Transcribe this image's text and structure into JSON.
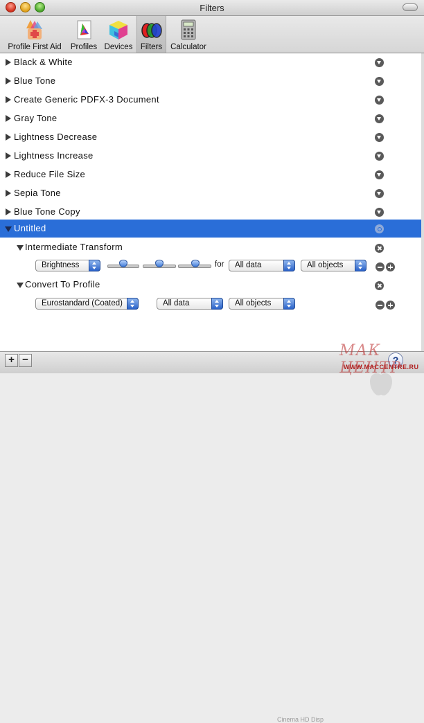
{
  "window": {
    "title": "Filters"
  },
  "toolbar": {
    "items": [
      {
        "label": "Profile First Aid",
        "icon": "profile-first-aid-icon",
        "selected": false
      },
      {
        "label": "Profiles",
        "icon": "profiles-icon",
        "selected": false
      },
      {
        "label": "Devices",
        "icon": "devices-icon",
        "selected": false
      },
      {
        "label": "Filters",
        "icon": "filters-icon",
        "selected": true
      },
      {
        "label": "Calculator",
        "icon": "calculator-icon",
        "selected": false
      }
    ]
  },
  "filters": [
    {
      "label": "Black & White"
    },
    {
      "label": "Blue Tone"
    },
    {
      "label": "Create Generic PDFX-3 Document"
    },
    {
      "label": "Gray Tone"
    },
    {
      "label": "Lightness Decrease"
    },
    {
      "label": "Lightness Increase"
    },
    {
      "label": "Reduce File Size"
    },
    {
      "label": "Sepia Tone"
    },
    {
      "label": "Blue Tone Copy"
    },
    {
      "label": "Untitled",
      "selected": true,
      "expanded": true
    }
  ],
  "components": {
    "intermediate": {
      "label": "Intermediate Transform",
      "type_value": "Brightness",
      "slider_values": [
        0.5,
        0.5,
        0.5
      ],
      "for_label": "for",
      "data_value": "All data",
      "objects_value": "All objects"
    },
    "convert": {
      "label": "Convert To Profile",
      "profile_value": "Eurostandard (Coated)",
      "data_value": "All data",
      "objects_value": "All objects"
    }
  },
  "bottombar": {
    "add_label": "+",
    "remove_label": "−",
    "help_label": "?"
  },
  "watermark": {
    "text": "МАК ЦЕНТР",
    "url": "WWW.MACCENTRE.RU",
    "strip_text": "Cinema HD Disp"
  },
  "colors": {
    "selection": "#2a6ed8",
    "accent": "#3f7ad9"
  }
}
